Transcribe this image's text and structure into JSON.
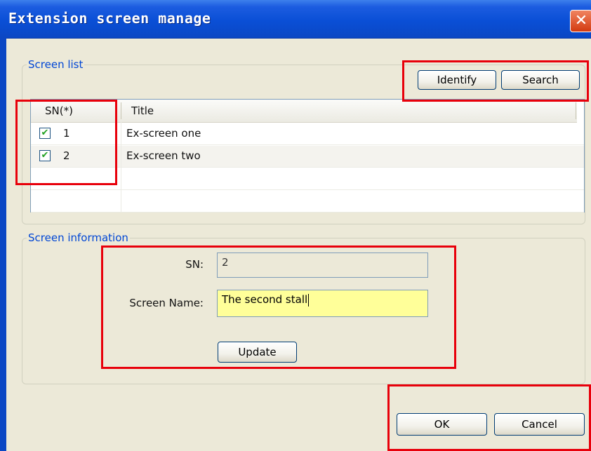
{
  "window": {
    "title": "Extension screen manage",
    "close_icon": "close-icon"
  },
  "screen_list": {
    "legend": "Screen list",
    "identify_label": "Identify",
    "search_label": "Search",
    "columns": [
      "SN(*)",
      "Title"
    ],
    "rows": [
      {
        "checked": true,
        "sn": "1",
        "title": "Ex-screen one"
      },
      {
        "checked": true,
        "sn": "2",
        "title": "Ex-screen two"
      }
    ]
  },
  "screen_info": {
    "legend": "Screen information",
    "sn_label": "SN:",
    "sn_value": "2",
    "name_label": "Screen Name:",
    "name_value": "The second stall",
    "update_label": "Update"
  },
  "footer": {
    "ok_label": "OK",
    "cancel_label": "Cancel"
  },
  "highlight_color": "#e8000b"
}
